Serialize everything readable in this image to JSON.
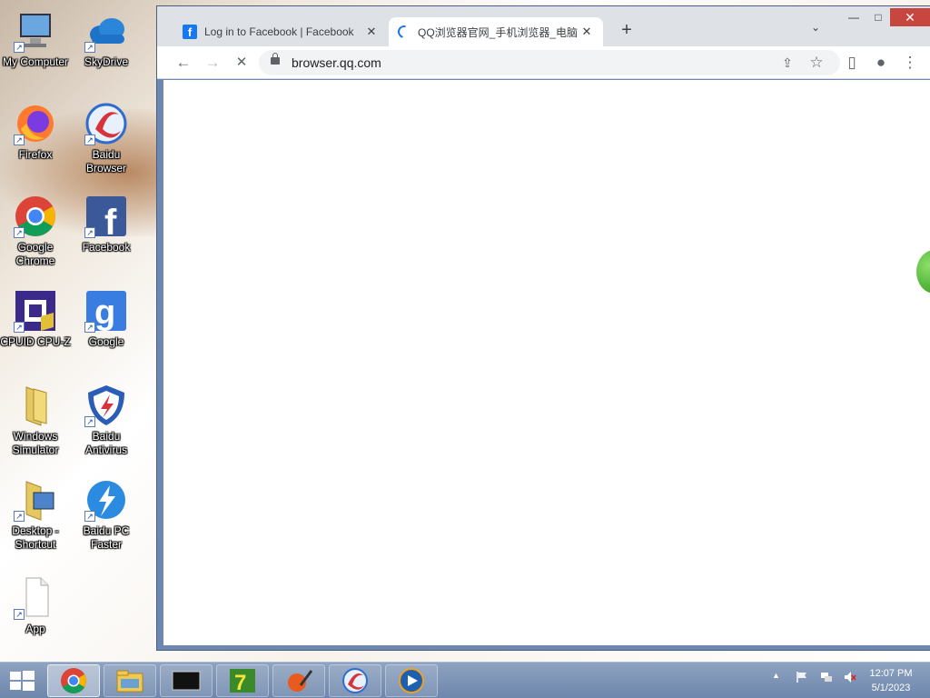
{
  "desktop": {
    "icons": [
      {
        "label": "My Computer"
      },
      {
        "label": "SkyDrive"
      },
      {
        "label": "Firefox"
      },
      {
        "label": "Baidu Browser"
      },
      {
        "label": "Google Chrome"
      },
      {
        "label": "Facebook"
      },
      {
        "label": "CPUID CPU-Z"
      },
      {
        "label": "Google"
      },
      {
        "label": "Windows Simulator"
      },
      {
        "label": "Baidu Antivirus"
      },
      {
        "label": "Desktop - Shortcut"
      },
      {
        "label": "Baidu PC Faster"
      },
      {
        "label": "App"
      }
    ]
  },
  "browser": {
    "tabs": [
      {
        "title": "Log in to Facebook | Facebook",
        "favicon": "facebook-icon",
        "close": "✕"
      },
      {
        "title": "QQ浏览器官网_手机浏览器_电脑",
        "favicon": "loading-spinner-icon",
        "close": "✕"
      }
    ],
    "new_tab": "+",
    "tab_search": "⌄",
    "window_controls": {
      "minimize": "—",
      "maximize": "□",
      "close": "✕"
    },
    "url": "browser.qq.com",
    "toolbar": {
      "back": "←",
      "forward": "→",
      "stop": "✕",
      "share": "⇪",
      "bookmark": "☆",
      "sidepanel": "▯",
      "profile": "●",
      "menu": "⋮"
    }
  },
  "taskbar": {
    "items": [
      "chrome-icon",
      "file-explorer-icon",
      "terminal-icon",
      "7zip-icon",
      "paint-icon",
      "baidu-browser-icon",
      "media-player-icon"
    ],
    "tray": {
      "overflow": "▲"
    },
    "clock": {
      "time": "12:07 PM",
      "date": "5/1/2023"
    }
  },
  "colors": {
    "close_button": "#c7463f",
    "taskbar": "#7a91b5",
    "accent": "#1a73e8"
  }
}
